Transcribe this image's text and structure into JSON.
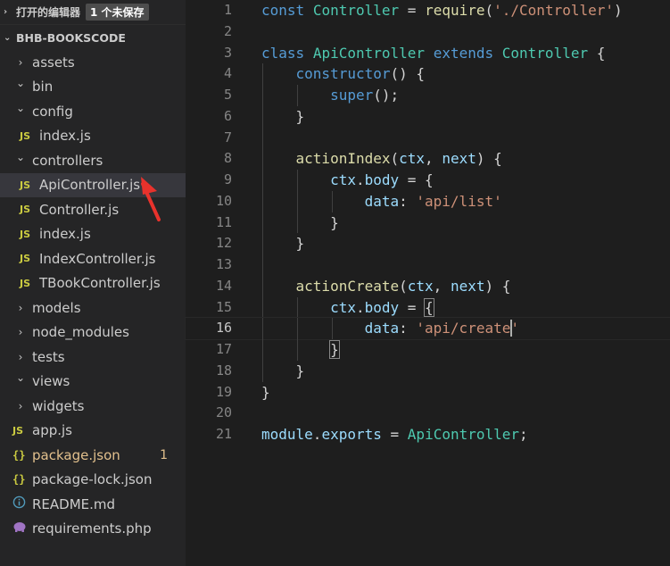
{
  "sidebar": {
    "open_editors_label": "打开的编辑器",
    "unsaved_badge": "1 个未保存",
    "root_folder": "BHB-BOOKSCODE",
    "items": [
      {
        "label": "assets",
        "type": "folder",
        "state": "collapsed"
      },
      {
        "label": "bin",
        "type": "folder",
        "state": "expanded"
      },
      {
        "label": "config",
        "type": "folder",
        "state": "expanded"
      },
      {
        "label": "index.js",
        "type": "js"
      },
      {
        "label": "controllers",
        "type": "folder",
        "state": "expanded"
      },
      {
        "label": "ApiController.js",
        "type": "js",
        "selected": true
      },
      {
        "label": "Controller.js",
        "type": "js"
      },
      {
        "label": "index.js",
        "type": "js"
      },
      {
        "label": "IndexController.js",
        "type": "js"
      },
      {
        "label": "TBookController.js",
        "type": "js"
      },
      {
        "label": "models",
        "type": "folder",
        "state": "collapsed"
      },
      {
        "label": "node_modules",
        "type": "folder",
        "state": "collapsed"
      },
      {
        "label": "tests",
        "type": "folder",
        "state": "collapsed"
      },
      {
        "label": "views",
        "type": "folder",
        "state": "expanded"
      },
      {
        "label": "widgets",
        "type": "folder",
        "state": "collapsed"
      },
      {
        "label": "app.js",
        "type": "js"
      },
      {
        "label": "package.json",
        "type": "json",
        "modified": true,
        "badge": "1"
      },
      {
        "label": "package-lock.json",
        "type": "json"
      },
      {
        "label": "README.md",
        "type": "info"
      },
      {
        "label": "requirements.php",
        "type": "php"
      }
    ],
    "js_icon_text": "JS",
    "json_icon_text": "{}"
  },
  "editor": {
    "line_numbers": [
      "1",
      "2",
      "3",
      "4",
      "5",
      "6",
      "7",
      "8",
      "9",
      "10",
      "11",
      "12",
      "13",
      "14",
      "15",
      "16",
      "17",
      "18",
      "19",
      "20",
      "21"
    ],
    "current_line": 16
  },
  "colors": {
    "keyword": "#569cd6",
    "class": "#4ec9b0",
    "function": "#dcdcaa",
    "variable": "#9cdcfe",
    "string": "#ce9178",
    "annotation_arrow": "#e8322c"
  }
}
